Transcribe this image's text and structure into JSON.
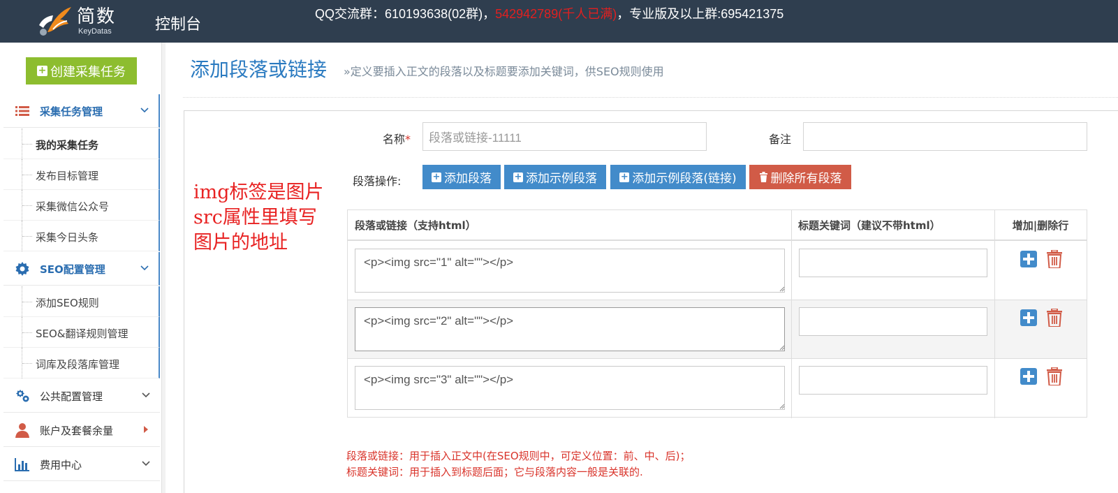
{
  "header": {
    "logo_text": "简数",
    "logo_sub": "KeyDatas",
    "console_label": "控制台",
    "notice_part1": "QQ交流群：610193638(02群)，",
    "notice_red": "542942789(千人已满)",
    "notice_part2": "，专业版及以上群:695421375"
  },
  "sidebar": {
    "create_button": "创建采集任务",
    "groups": [
      {
        "label": "采集任务管理",
        "icon": "list-icon"
      },
      {
        "label": "SEO配置管理",
        "icon": "gear-icon"
      },
      {
        "label": "公共配置管理",
        "icon": "gears-icon"
      },
      {
        "label": "账户及套餐余量",
        "icon": "user-icon"
      },
      {
        "label": "费用中心",
        "icon": "bar-chart-icon"
      }
    ],
    "task_items": [
      "我的采集任务",
      "发布目标管理",
      "采集微信公众号",
      "采集今日头条"
    ],
    "seo_items": [
      "添加SEO规则",
      "SEO&翻译规则管理",
      "词库及段落库管理"
    ]
  },
  "page": {
    "title": "添加段落或链接",
    "subtitle": "»定义要插入正文的段落以及标题要添加关键词，供SEO规则使用"
  },
  "form": {
    "name_label": "名称",
    "name_required": "*",
    "name_placeholder": "段落或链接-11111",
    "remark_label": "备注",
    "remark_value": "",
    "ops_label": "段落操作:",
    "buttons": {
      "add_paragraph": "添加段落",
      "add_sample": "添加示例段落",
      "add_sample_link": "添加示例段落(链接)",
      "delete_all": "删除所有段落"
    }
  },
  "annotation": {
    "line1": "img标签是图片",
    "line2": "src属性里填写",
    "line3": "图片的地址"
  },
  "table": {
    "headers": [
      "段落或链接（支持html）",
      "标题关键词（建议不带html）",
      "增加|删除行"
    ],
    "rows": [
      {
        "paragraph": "<p><img src=\"1\" alt=\"\"></p>",
        "keyword": ""
      },
      {
        "paragraph": "<p><img src=\"2\" alt=\"\"></p>",
        "keyword": ""
      },
      {
        "paragraph": "<p><img src=\"3\" alt=\"\"></p>",
        "keyword": ""
      }
    ]
  },
  "notes": {
    "line1": "段落或链接：用于插入正文中(在SEO规则中，可定义位置：前、中、后)；",
    "line2": "标题关键词：用于插入到标题后面；它与段落内容一般是关联的."
  },
  "colors": {
    "topbar": "#2f3e4f",
    "create_green": "#8dbd2f",
    "primary_blue": "#428bca",
    "danger_red": "#d15b47",
    "annotation_red": "#e82222"
  }
}
